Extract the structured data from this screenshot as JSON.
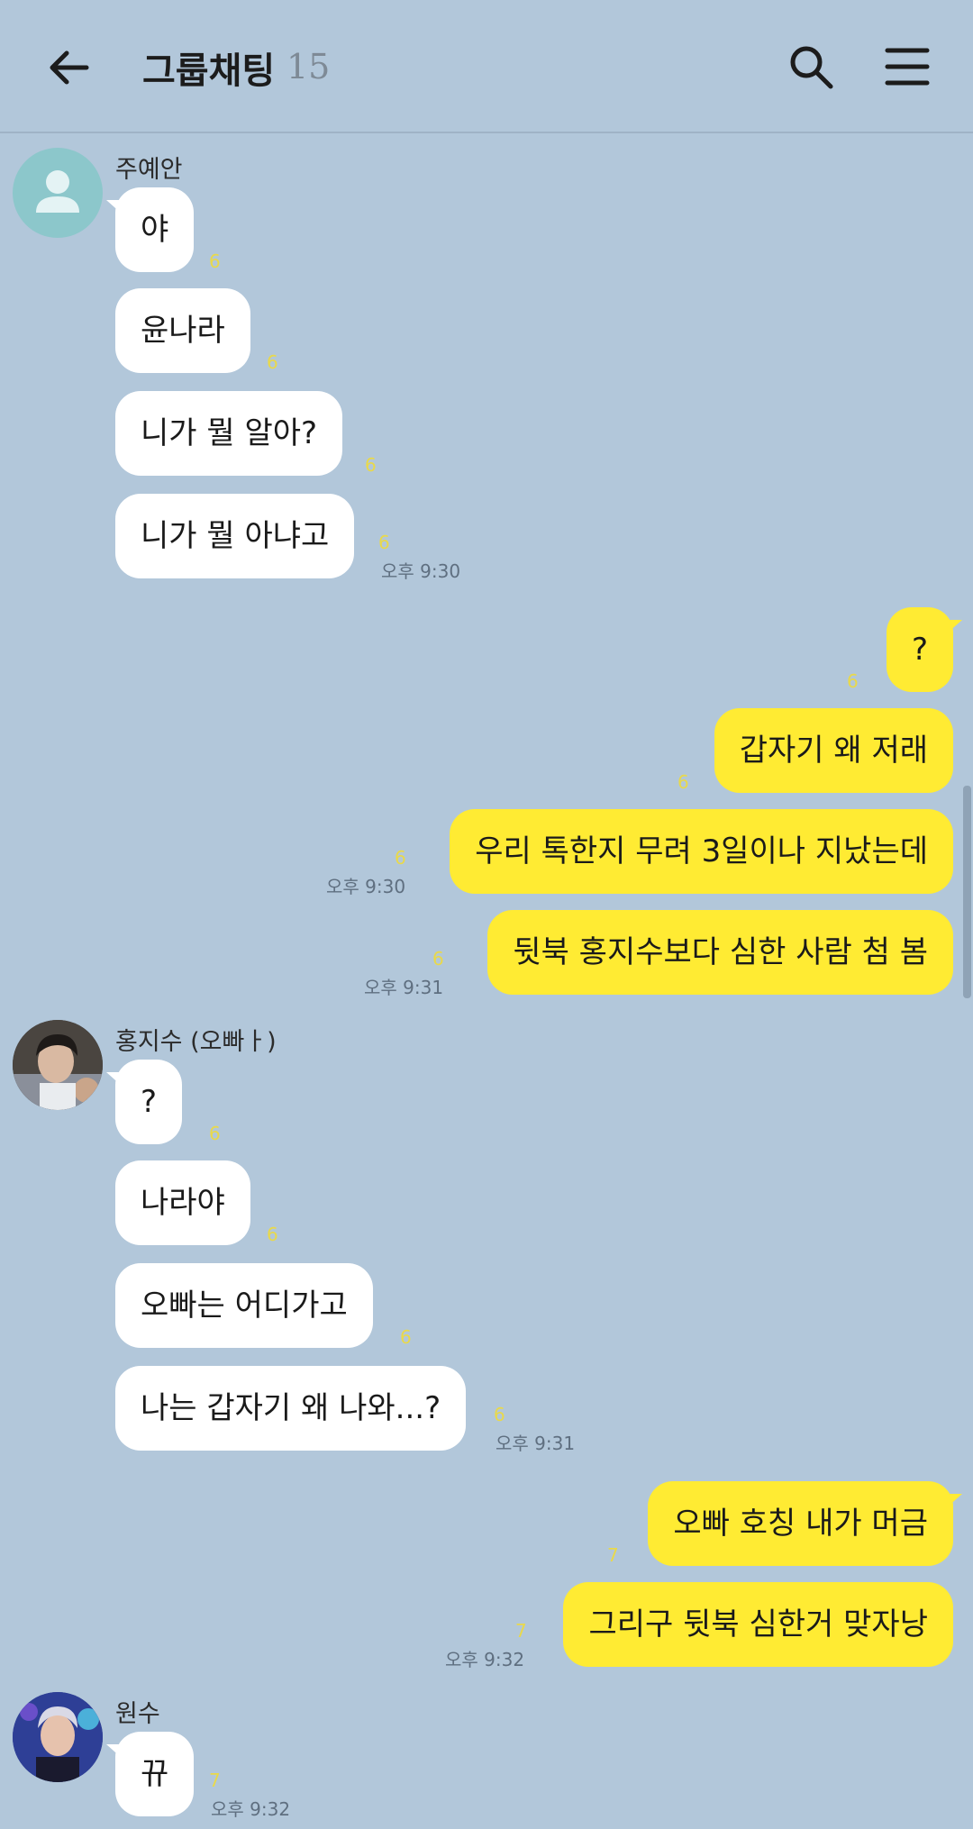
{
  "header": {
    "title": "그룹채팅",
    "member_count": "15"
  },
  "messages": [
    {
      "sender": "주예안",
      "avatar": "default-person-icon",
      "items": [
        {
          "text": "야",
          "unread": "6"
        },
        {
          "text": "윤나라",
          "unread": "6"
        },
        {
          "text": "니가 뭘 알아?",
          "unread": "6"
        },
        {
          "text": "니가 뭘 아냐고",
          "unread": "6",
          "time": "오후 9:30"
        }
      ]
    },
    {
      "sender": "me",
      "items": [
        {
          "text": "?",
          "unread": "6"
        },
        {
          "text": "갑자기 왜 저래",
          "unread": "6"
        },
        {
          "text": "우리 톡한지 무려 3일이나 지났는데",
          "unread": "6",
          "time": "오후 9:30"
        },
        {
          "text": "뒷북 홍지수보다 심한 사람 첨 봄",
          "unread": "6",
          "time": "오후 9:31"
        }
      ]
    },
    {
      "sender": "홍지수 (오빠ㅏ)",
      "avatar": "profile-photo",
      "items": [
        {
          "text": "?",
          "unread": "6"
        },
        {
          "text": "나라야",
          "unread": "6"
        },
        {
          "text": "오빠는 어디가고",
          "unread": "6"
        },
        {
          "text": "나는 갑자기 왜 나와...?",
          "unread": "6",
          "time": "오후 9:31"
        }
      ]
    },
    {
      "sender": "me",
      "items": [
        {
          "text": "오빠 호칭 내가 머금",
          "unread": "7"
        },
        {
          "text": "그리구 뒷북 심한거 맞자낭",
          "unread": "7",
          "time": "오후 9:32"
        }
      ]
    },
    {
      "sender": "원수",
      "avatar": "profile-photo",
      "items": [
        {
          "text": "뀨",
          "unread": "7",
          "time": "오후 9:32"
        }
      ]
    }
  ],
  "colors": {
    "background": "#b2c7da",
    "incoming_bubble": "#ffffff",
    "outgoing_bubble": "#ffeb33",
    "unread": "#e9d94a"
  }
}
